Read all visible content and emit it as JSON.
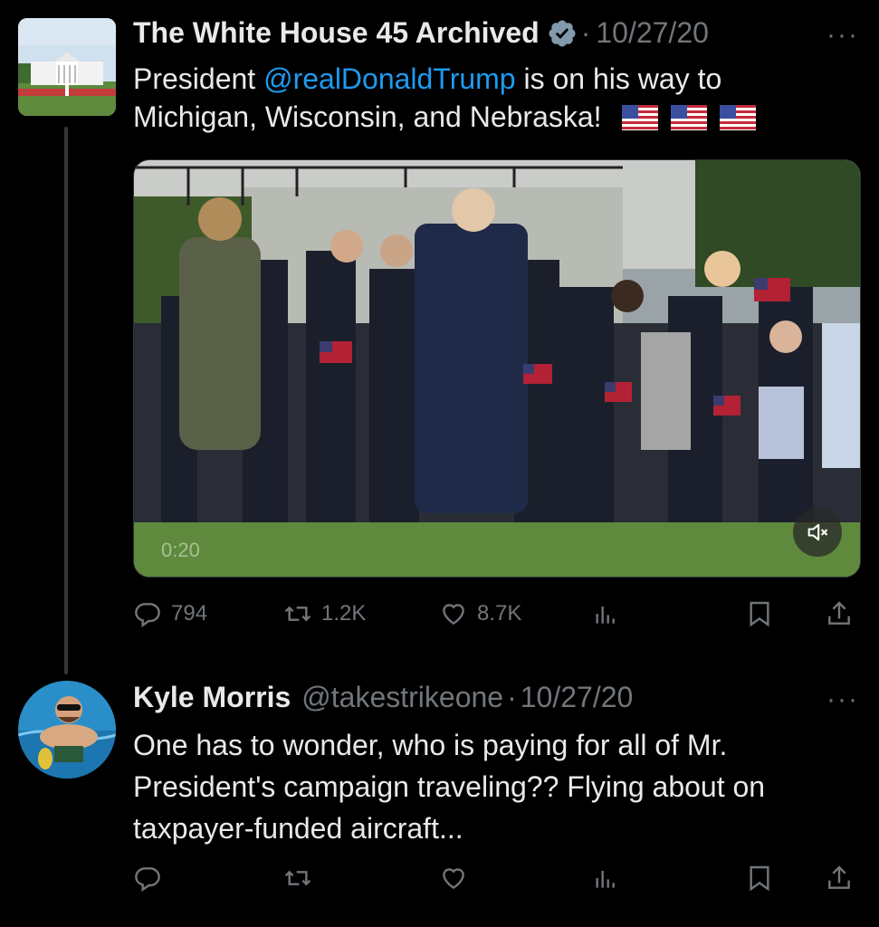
{
  "tweet1": {
    "display_name": "The White House 45 Archived",
    "separator": "·",
    "date": "10/27/20",
    "more": "···",
    "text_before": "President ",
    "mention": "@realDonaldTrump",
    "text_after": " is on his way to Michigan, Wisconsin, and Nebraska!",
    "flag_count": 3,
    "video_time": "0:20",
    "replies": "794",
    "retweets": "1.2K",
    "likes": "8.7K"
  },
  "tweet2": {
    "display_name": "Kyle Morris",
    "handle": "@takestrikeone",
    "separator": "·",
    "date": "10/27/20",
    "more": "···",
    "text": "One has to wonder, who is paying for all of Mr. President's campaign traveling??  Flying about on taxpayer-funded aircraft..."
  },
  "icons": [
    "verified-badge-icon",
    "reply-icon",
    "retweet-icon",
    "like-icon",
    "views-icon",
    "bookmark-icon",
    "share-icon",
    "mute-icon",
    "more-icon",
    "us-flag-icon"
  ],
  "colors": {
    "background": "#000000",
    "text": "#e7e9ea",
    "muted": "#71767b",
    "link": "#1d9bf0"
  }
}
